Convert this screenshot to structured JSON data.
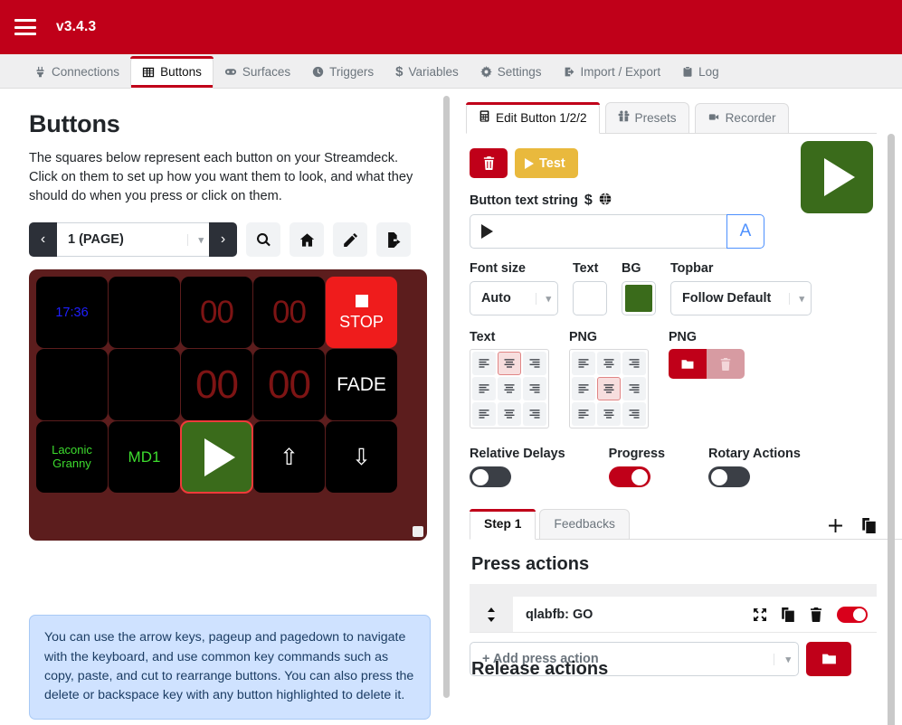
{
  "header": {
    "version": "v3.4.3",
    "menu_icon": "hamburger-icon"
  },
  "tabs": [
    {
      "label": "Connections",
      "icon": "plug-icon",
      "active": false
    },
    {
      "label": "Buttons",
      "icon": "grid-icon",
      "active": true
    },
    {
      "label": "Surfaces",
      "icon": "gamepad-icon",
      "active": false
    },
    {
      "label": "Triggers",
      "icon": "clock-icon",
      "active": false
    },
    {
      "label": "Variables",
      "icon": "dollar-icon",
      "active": false
    },
    {
      "label": "Settings",
      "icon": "gear-icon",
      "active": false
    },
    {
      "label": "Import / Export",
      "icon": "import-export-icon",
      "active": false
    },
    {
      "label": "Log",
      "icon": "clipboard-icon",
      "active": false
    }
  ],
  "left": {
    "title": "Buttons",
    "description": "The squares below represent each button on your Streamdeck. Click on them to set up how you want them to look, and what they should do when you press or click on them.",
    "page_select": {
      "value": "1 (PAGE)",
      "prev_icon": "chevron-left-icon",
      "next_icon": "chevron-right-icon"
    },
    "toolbar_icons": [
      "search-icon",
      "home-icon",
      "pencil-icon",
      "export-icon"
    ],
    "deck": {
      "rows": [
        [
          {
            "text": "17:36",
            "color": "#1f1fff",
            "bg": "#000000",
            "size": 14.5
          },
          {
            "text": "",
            "color": "#ffffff",
            "bg": "#000000"
          },
          {
            "text": "00",
            "color": "#7d1414",
            "bg": "#000000",
            "style": "big"
          },
          {
            "text": "00",
            "color": "#7d1414",
            "bg": "#000000",
            "style": "big"
          },
          {
            "text": "STOP",
            "color": "#ffffff",
            "bg": "#ef1c1c",
            "style": "stop"
          }
        ],
        [
          {
            "text": "",
            "color": "#ffffff",
            "bg": "#000000"
          },
          {
            "text": "",
            "color": "#ffffff",
            "bg": "#000000"
          },
          {
            "text": "00",
            "color": "#7d1414",
            "bg": "#000000",
            "style": "big-lg"
          },
          {
            "text": "00",
            "color": "#7d1414",
            "bg": "#000000",
            "style": "big-lg"
          },
          {
            "text": "FADE",
            "color": "#ffffff",
            "bg": "#000000",
            "size": 21
          }
        ],
        [
          {
            "text": "Laconic Granny",
            "color": "#3ddc2e",
            "bg": "#000000",
            "size": 13
          },
          {
            "text": "MD1",
            "color": "#3ddc2e",
            "bg": "#000000",
            "size": 17
          },
          {
            "text": "",
            "color": "#ffffff",
            "bg": "#3a6b1b",
            "style": "play",
            "selected": true
          },
          {
            "text": "⇧",
            "color": "#ffffff",
            "bg": "#000000",
            "size": 25
          },
          {
            "text": "⇩",
            "color": "#ffffff",
            "bg": "#000000",
            "size": 25
          }
        ]
      ]
    },
    "info_text": "You can use the arrow keys, pageup and pagedown to navigate with the keyboard, and use common key commands such as copy, paste, and cut to rearrange buttons. You can also press the delete or backspace key with any button highlighted to delete it."
  },
  "right": {
    "tabs": [
      {
        "label": "Edit Button 1/2/2",
        "icon": "calculator-icon",
        "active": true
      },
      {
        "label": "Presets",
        "icon": "gift-icon",
        "active": false
      },
      {
        "label": "Recorder",
        "icon": "video-camera-icon",
        "active": false
      }
    ],
    "delete_icon": "trash-icon",
    "test_label": "Test",
    "button_text_label": "Button text string",
    "button_text_value": "",
    "variables_icon": "dollar-icon",
    "globe_icon": "globe-icon",
    "text_format_button": "A",
    "font_size": {
      "label": "Font size",
      "value": "Auto"
    },
    "text_color": {
      "label": "Text",
      "value": "#ffffff"
    },
    "bg_color": {
      "label": "BG",
      "value": "#3a6b1b"
    },
    "topbar": {
      "label": "Topbar",
      "value": "Follow Default"
    },
    "align_text": {
      "label": "Text",
      "selected_index": 1
    },
    "align_png": {
      "label": "PNG",
      "selected_index": 4
    },
    "png_actions": {
      "label": "PNG",
      "browse_icon": "folder-icon",
      "delete_icon": "trash-icon"
    },
    "toggles": [
      {
        "label": "Relative Delays",
        "on": false
      },
      {
        "label": "Progress",
        "on": true
      },
      {
        "label": "Rotary Actions",
        "on": false
      }
    ],
    "step_tabs": [
      {
        "label": "Step 1",
        "active": true
      },
      {
        "label": "Feedbacks",
        "active": false
      }
    ],
    "step_tools": [
      "plus-icon",
      "duplicate-icon"
    ],
    "press_actions_title": "Press actions",
    "actions": [
      {
        "name": "qlabfb: GO",
        "drag_icon": "drag-handle-icon",
        "expand_icon": "expand-icon",
        "copy_icon": "duplicate-icon",
        "delete_icon": "trash-icon",
        "enabled": true
      }
    ],
    "add_action": {
      "placeholder": "+ Add press action",
      "folder_icon": "folder-icon"
    },
    "next_section_partial": "Release actions"
  },
  "colors": {
    "brand_red": "#c00019",
    "accent_yellow": "#e9b93d",
    "deck_bg": "#5c1d1d",
    "green": "#3a6b1b",
    "info_bg": "#cfe2ff"
  }
}
